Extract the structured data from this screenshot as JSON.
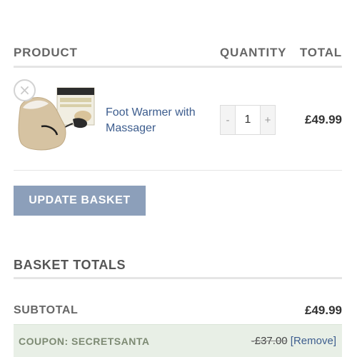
{
  "table_header": {
    "product": "PRODUCT",
    "quantity": "QUANTITY",
    "total": "TOTAL"
  },
  "cart_item": {
    "remove_symbol": "×",
    "product_name": "Foot Warmer with Massager",
    "quantity": "1",
    "decrement": "-",
    "increment": "+",
    "total": "£49.99",
    "image_icon": "foot-warmer-product-photo"
  },
  "update_basket_label": "UPDATE BASKET",
  "basket_totals": {
    "title": "BASKET TOTALS",
    "subtotal_label": "SUBTOTAL",
    "subtotal_value": "£49.99",
    "coupon_label": "COUPON: SECRETSANTA",
    "coupon_value": "-£37.00",
    "coupon_remove": "[Remove]"
  },
  "colors": {
    "link": "#3d5d8e",
    "update_button": "#8c9fba",
    "coupon_bg": "#e8efe6"
  }
}
